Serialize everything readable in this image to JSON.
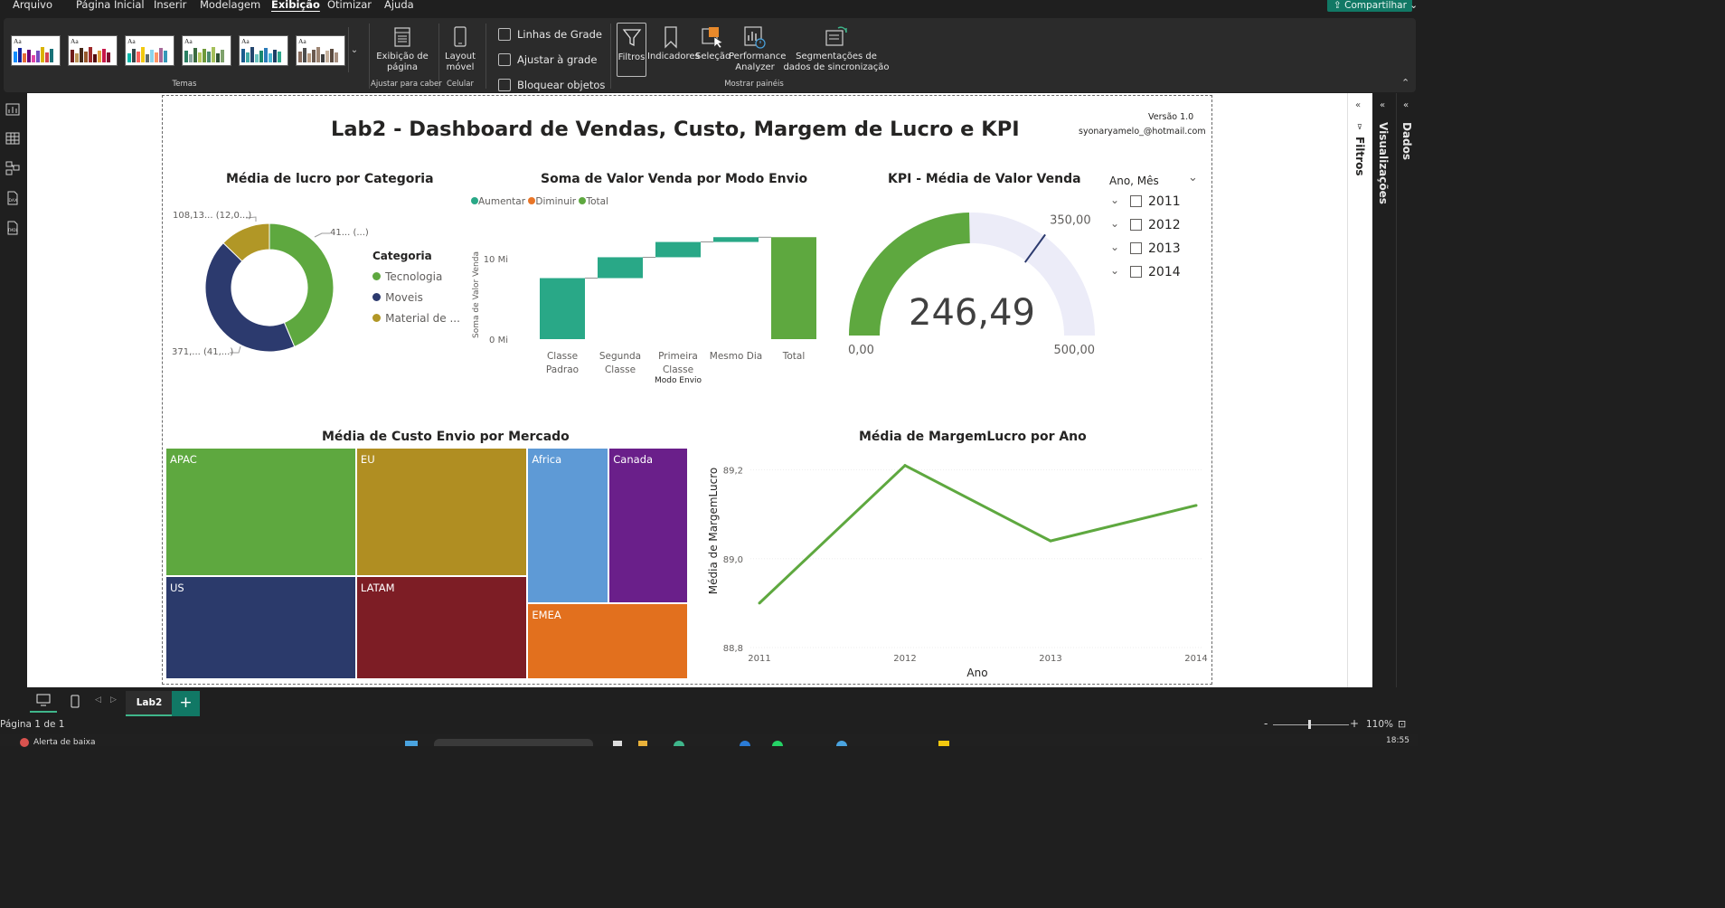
{
  "menu": {
    "items": [
      "Arquivo",
      "Página Inicial",
      "Inserir",
      "Modelagem",
      "Exibição",
      "Otimizar",
      "Ajuda"
    ],
    "share_label": "Compartilhar"
  },
  "ribbon": {
    "themes_label": "Temas",
    "page_view_label": "Exibição de página",
    "fit_group_label": "Ajustar para caber",
    "mobile_layout_label": "Layout móvel",
    "mobile_group_label": "Celular",
    "gridlines_label": "Linhas de Grade",
    "snap_label": "Ajustar à grade",
    "lock_label": "Bloquear objetos",
    "filters_label": "Filtros",
    "bookmarks_label": "Indicadores",
    "selection_label": "Seleção",
    "perf_label": "Performance Analyzer",
    "sync_label": "Segmentações de dados de sincronização",
    "panes_group_label": "Mostrar painéis"
  },
  "report": {
    "title": "Lab2 -  Dashboard de Vendas, Custo, Margem de Lucro e KPI",
    "version": "Versão 1.0",
    "email": "syonaryamelo_@hotmail.com"
  },
  "donut": {
    "title": "Média de lucro por Categoria",
    "legend_title": "Categoria",
    "label_top_right": "41... (...)",
    "label_top_left": "108,13... (12,0...)",
    "label_bottom": "371,... (41,...)",
    "legend": [
      {
        "name": "Tecnologia",
        "color": "#5ea83f"
      },
      {
        "name": "Moveis",
        "color": "#2c3a6e"
      },
      {
        "name": "Material de ...",
        "color": "#b19726"
      }
    ]
  },
  "waterfall": {
    "title": "Soma de Valor Venda por Modo Envio",
    "legend": [
      {
        "name": "Aumentar",
        "color": "#29a887"
      },
      {
        "name": "Diminuir",
        "color": "#e97527"
      },
      {
        "name": "Total",
        "color": "#5ea83f"
      }
    ],
    "ylabel": "Soma de Valor Venda",
    "xlabel": "Modo Envio",
    "yticks": [
      "10 Mi",
      "0 Mi"
    ],
    "categories": [
      "Classe Padrao",
      "Segunda Classe",
      "Primeira Classe",
      "Mesmo Dia",
      "Total"
    ]
  },
  "gauge": {
    "title": "KPI - Média de Valor Venda",
    "value_label": "246,49",
    "min_label": "0,00",
    "max_label": "500,00",
    "target_label": "350,00"
  },
  "slicer": {
    "title": "Ano, Mês",
    "years": [
      "2011",
      "2012",
      "2013",
      "2014"
    ]
  },
  "treemap": {
    "title": "Média de Custo Envio por Mercado",
    "tiles": [
      {
        "name": "APAC",
        "color": "#5ea83f"
      },
      {
        "name": "EU",
        "color": "#b08e22"
      },
      {
        "name": "Africa",
        "color": "#5e9ad6"
      },
      {
        "name": "Canada",
        "color": "#6a1f8a"
      },
      {
        "name": "US",
        "color": "#2b3a6b"
      },
      {
        "name": "LATAM",
        "color": "#7d1d25"
      },
      {
        "name": "EMEA",
        "color": "#e2701e"
      }
    ]
  },
  "linechart": {
    "title": "Média de MargemLucro por Ano",
    "ylabel": "Média de MargemLucro",
    "xlabel": "Ano",
    "yticks": [
      "89,2",
      "89,0",
      "88,8"
    ],
    "xticks": [
      "2011",
      "2012",
      "2013",
      "2014"
    ]
  },
  "chart_data": [
    {
      "type": "pie",
      "title": "Média de lucro por Categoria",
      "categories": [
        "Tecnologia",
        "Moveis",
        "Material de ..."
      ],
      "values": [
        41,
        41,
        12
      ],
      "unit": "%"
    },
    {
      "type": "bar",
      "subtype": "waterfall",
      "title": "Soma de Valor Venda por Modo Envio",
      "xlabel": "Modo Envio",
      "ylabel": "Soma de Valor Venda",
      "categories": [
        "Classe Padrao",
        "Segunda Classe",
        "Primeira Classe",
        "Mesmo Dia",
        "Total"
      ],
      "values": [
        7.6,
        2.6,
        1.9,
        0.6,
        12.7
      ],
      "unit": "Mi",
      "ylim": [
        0,
        14
      ]
    },
    {
      "type": "gauge",
      "title": "KPI - Média de Valor Venda",
      "value": 246.49,
      "min": 0,
      "max": 500,
      "target": 350
    },
    {
      "type": "treemap",
      "title": "Média de Custo Envio por Mercado",
      "categories": [
        "APAC",
        "EU",
        "Africa",
        "Canada",
        "US",
        "LATAM",
        "EMEA"
      ],
      "values": [
        31.6,
        28.3,
        16.3,
        15.9,
        25.4,
        22.9,
        15.8
      ]
    },
    {
      "type": "line",
      "title": "Média de MargemLucro por Ano",
      "xlabel": "Ano",
      "ylabel": "Média de MargemLucro",
      "x": [
        "2011",
        "2012",
        "2013",
        "2014"
      ],
      "series": [
        {
          "values": [
            88.9,
            89.21,
            89.04,
            89.12
          ],
          "color": "#5ea83f"
        }
      ],
      "ylim": [
        88.8,
        89.25
      ]
    }
  ],
  "pages": {
    "tab_label": "Lab2",
    "page_count": "Página 1 de 1",
    "zoom": "110%",
    "clock": "18:55",
    "taskbar_alert": "Alerta de baixa"
  }
}
